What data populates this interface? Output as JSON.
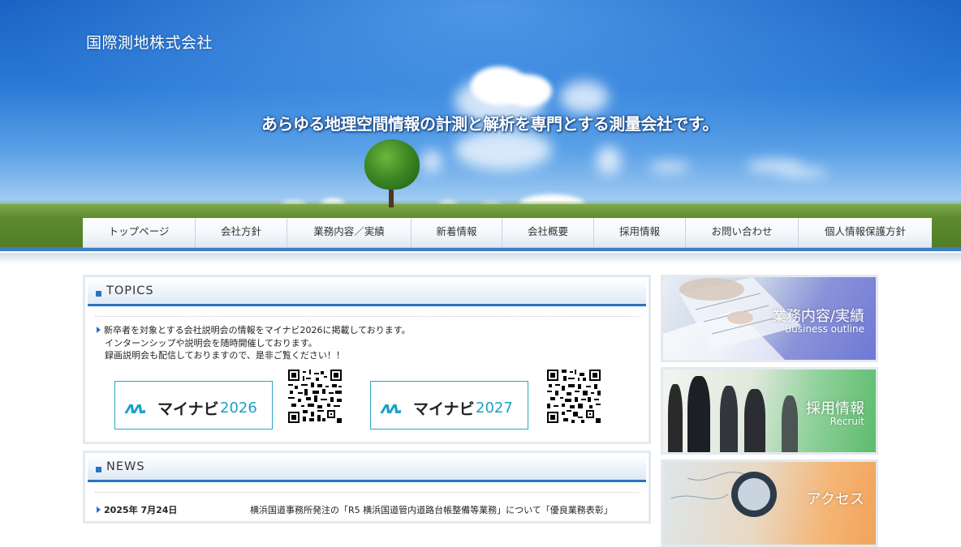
{
  "header": {
    "company_name": "国際測地株式会社",
    "tagline": "あらゆる地理空間情報の計測と解析を専門とする測量会社です。"
  },
  "nav": {
    "items": [
      {
        "label": "トップページ"
      },
      {
        "label": "会社方針"
      },
      {
        "label": "業務内容／実績"
      },
      {
        "label": "新着情報"
      },
      {
        "label": "会社概要"
      },
      {
        "label": "採用情報"
      },
      {
        "label": "お問い合わせ"
      },
      {
        "label": "個人情報保護方針"
      }
    ]
  },
  "topics": {
    "title": "TOPICS",
    "lines": [
      "新卒者を対象とする会社説明会の情報をマイナビ2026に掲載しております。",
      "インターンシップや説明会を随時開催しております。",
      "録画説明会も配信しておりますので、是非ご覧ください！！"
    ],
    "banners": [
      {
        "brand": "マイナビ",
        "year": "2026"
      },
      {
        "brand": "マイナビ",
        "year": "2027"
      }
    ]
  },
  "news": {
    "title": "NEWS",
    "items": [
      {
        "date": "2025年 7月24日",
        "text": "横浜国道事務所発注の「R5 横浜国道管内道路台帳整備等業務」について「優良業務表彰」"
      }
    ]
  },
  "side_banners": [
    {
      "jp": "業務内容/実績",
      "en": "Business outline",
      "color": "#6f78d6"
    },
    {
      "jp": "採用情報",
      "en": "Recruit",
      "color": "#5cbc6c"
    },
    {
      "jp": "アクセス",
      "en": "",
      "color": "#f2a35a"
    }
  ]
}
